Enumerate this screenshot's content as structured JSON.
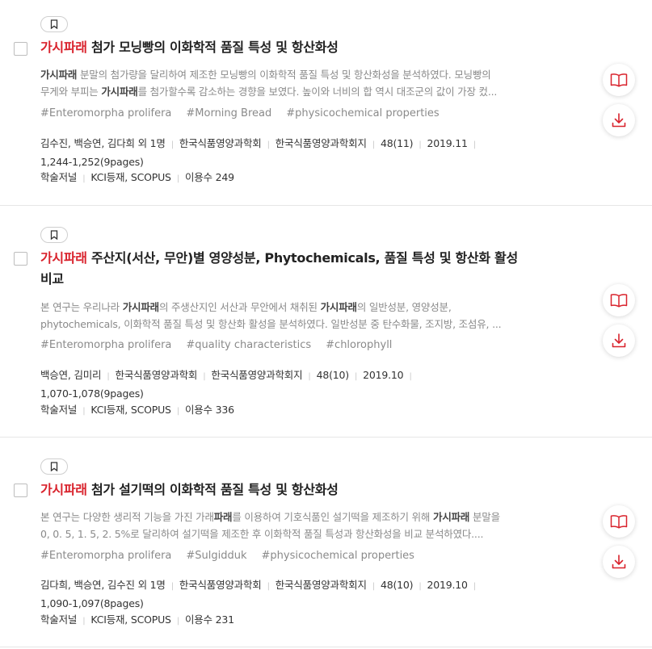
{
  "results": [
    {
      "title_highlight": "가시파래",
      "title_rest": " 첨가 모닝빵의 이화학적 품질 특성 및 항산화성",
      "abstract_line1_b": "가시파래",
      "abstract_line1_rest": " 분말의 첨가량을 달리하여 제조한 모닝빵의 이화학적 품질 특성 및 항산화성을 분석하였다. 모닝빵의",
      "abstract_line2_pre": "무게와 부피는 ",
      "abstract_line2_b": "가시파래",
      "abstract_line2_rest": "를 첨가할수록 감소하는 경향을 보였다. 높이와 너비의 합 역시 대조군의 값이 가장 컸...",
      "tags": [
        "#Enteromorpha prolifera",
        "#Morning Bread",
        "#physicochemical properties"
      ],
      "authors": "김수진, 백승연, 김다희 외 1명",
      "society": "한국식품영양과학회",
      "journal": "한국식품영양과학회지",
      "volume": "48(11)",
      "date": "2019.11",
      "pages": "1,244-1,252(9pages)",
      "type": "학술저널",
      "index": "KCI등재, SCOPUS",
      "usage": "이용수 249"
    },
    {
      "title_highlight": "가시파래",
      "title_rest": " 주산지(서산, 무안)별 영양성분, Phytochemicals, 품질 특성 및 항산화 활성",
      "title_line2": "비교",
      "abstract_line1_pre": "본 연구는 우리나라 ",
      "abstract_line1_b": "가시파래",
      "abstract_line1_mid": "의 주생산지인 서산과 무안에서 채취된 ",
      "abstract_line1_b2": "가시파래",
      "abstract_line1_rest": "의 일반성분, 영양성분,",
      "abstract_line2": "phytochemicals, 이화학적 품질 특성 및 항산화 활성을 분석하였다. 일반성분 중 탄수화물, 조지방, 조섬유, ...",
      "tags": [
        "#Enteromorpha prolifera",
        "#quality characteristics",
        "#chlorophyll"
      ],
      "authors": "백승연, 김미리",
      "society": "한국식품영양과학회",
      "journal": "한국식품영양과학회지",
      "volume": "48(10)",
      "date": "2019.10",
      "pages": "1,070-1,078(9pages)",
      "type": "학술저널",
      "index": "KCI등재, SCOPUS",
      "usage": "이용수 336"
    },
    {
      "title_highlight": "가시파래",
      "title_rest": " 첨가 설기떡의 이화학적 품질 특성 및 항산화성",
      "abstract_line1_pre": "본 연구는 다양한 생리적 기능을 가진 가래",
      "abstract_line1_b": "파래",
      "abstract_line1_mid": "를 이용하여 기호식품인 설기떡을 제조하기 위해 ",
      "abstract_line1_b2": "가시파래",
      "abstract_line1_rest": " 분말을",
      "abstract_line2": "0, 0. 5, 1. 5, 2. 5%로 달리하여 설기떡을 제조한 후 이화학적 품질 특성과 항산화성을 비교 분석하였다....",
      "tags": [
        "#Enteromorpha prolifera",
        "#Sulgidduk",
        "#physicochemical properties"
      ],
      "authors": "김다희, 백승연, 김수진 외 1명",
      "society": "한국식품영양과학회",
      "journal": "한국식품영양과학회지",
      "volume": "48(10)",
      "date": "2019.10",
      "pages": "1,090-1,097(8pages)",
      "type": "학술저널",
      "index": "KCI등재, SCOPUS",
      "usage": "이용수 231"
    }
  ],
  "icons": {
    "bookmark": "bookmark-icon",
    "read": "open-book-icon",
    "download": "download-icon"
  },
  "colors": {
    "highlight": "#d9232d",
    "icon": "#d9232d"
  }
}
